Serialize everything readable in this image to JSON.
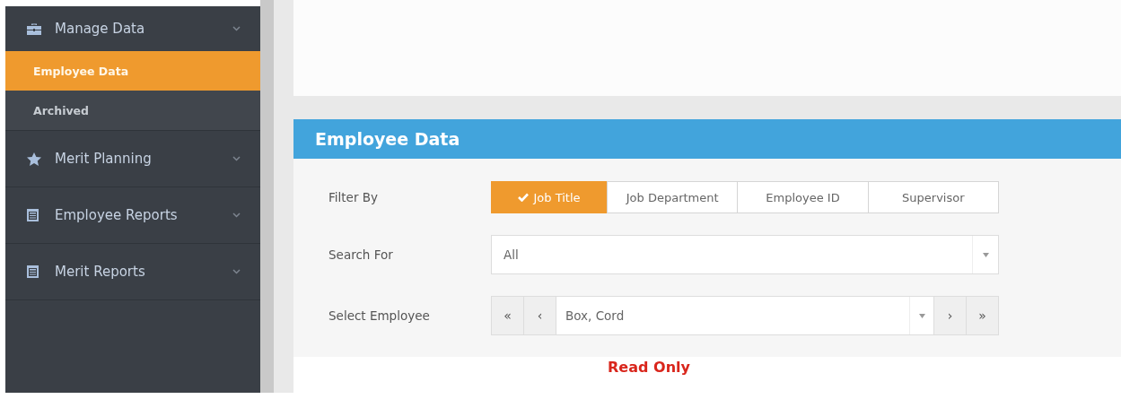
{
  "sidebar": {
    "items": [
      {
        "label": "Manage Data",
        "expanded": true,
        "children": [
          {
            "label": "Employee Data",
            "selected": true
          },
          {
            "label": "Archived",
            "selected": false
          }
        ]
      },
      {
        "label": "Merit Planning",
        "expanded": false
      },
      {
        "label": "Employee Reports",
        "expanded": false
      },
      {
        "label": "Merit Reports",
        "expanded": false
      }
    ]
  },
  "panel": {
    "title": "Employee Data",
    "filter": {
      "label": "Filter By",
      "options": [
        {
          "label": "Job Title",
          "selected": true
        },
        {
          "label": "Job Department",
          "selected": false
        },
        {
          "label": "Employee ID",
          "selected": false
        },
        {
          "label": "Supervisor",
          "selected": false
        }
      ]
    },
    "search": {
      "label": "Search For",
      "value": "All"
    },
    "employee": {
      "label": "Select Employee",
      "first": "«",
      "prev": "‹",
      "value": "Box, Cord",
      "next": "›",
      "last": "»"
    }
  },
  "status": "Read Only"
}
